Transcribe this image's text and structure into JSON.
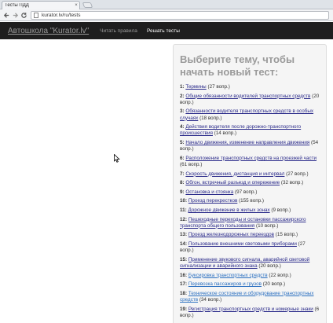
{
  "browser": {
    "tab_title": "Тесты ПДД",
    "tab_close": "×",
    "url": "kurator.lv/ru/tests"
  },
  "navbar": {
    "brand": "Автошкола \"Kurator.lv\"",
    "links": [
      {
        "label": "Читать правила",
        "active": false
      },
      {
        "label": "Решать тесты",
        "active": true
      }
    ]
  },
  "panel": {
    "title": "Выберите тему, чтобы начать новый тест:",
    "topics": [
      {
        "num": "1:",
        "name": "Термины",
        "count": "(27 вопр.)"
      },
      {
        "num": "2:",
        "name": "Общие обязанности водителей транспортных средств",
        "count": "(20 вопр.)"
      },
      {
        "num": "3:",
        "name": "Обязанности водителя транспортных средств в особых случаях",
        "count": "(18 вопр.)"
      },
      {
        "num": "4:",
        "name": "Действия водителя после дорожно-транспортного происшествия",
        "count": "(14 вопр.)"
      },
      {
        "num": "5:",
        "name": "Начало движения, изменение направления движения",
        "count": "(54 вопр.)"
      },
      {
        "num": "6:",
        "name": "Расположение транспортных средств на проезжей части",
        "count": "(61 вопр.)"
      },
      {
        "num": "7:",
        "name": "Скорость движения, дистанция и интервал",
        "count": "(27 вопр.)"
      },
      {
        "num": "8:",
        "name": "Обгон, встречный разъезд и опережение",
        "count": "(32 вопр.)"
      },
      {
        "num": "9:",
        "name": "Остановка и стоянка",
        "count": "(97 вопр.)"
      },
      {
        "num": "10:",
        "name": "Проезд перекрестков",
        "count": "(155 вопр.)"
      },
      {
        "num": "11:",
        "name": "Дорожное движение в жилых зонах",
        "count": "(9 вопр.)"
      },
      {
        "num": "12:",
        "name": "Пешеходные переходы и остановки пассажирского транспорта общего пользования",
        "count": "(10 вопр.)"
      },
      {
        "num": "13:",
        "name": "Проезд железнодорожных переездов",
        "count": "(15 вопр.)"
      },
      {
        "num": "14:",
        "name": "Пользование внешними световыми приборами",
        "count": "(27 вопр.)"
      },
      {
        "num": "15:",
        "name": "Применение звукового сигнала, аварийной световой сигнализации и аварийного знака",
        "count": "(20 вопр.)"
      },
      {
        "num": "16:",
        "name": "Буксировка транспортных средств",
        "count": "(22 вопр.)",
        "blue": true
      },
      {
        "num": "17:",
        "name": "Перевозка пассажиров и грузов",
        "count": "(20 вопр.)",
        "blue": true
      },
      {
        "num": "18:",
        "name": "Техническое состояние и оборудование транспортных средств",
        "count": "(34 вопр.)",
        "blue": true
      },
      {
        "num": "19:",
        "name": "Регистрация транспортных средств и номерные знаки",
        "count": "(6 вопр.)"
      }
    ]
  }
}
